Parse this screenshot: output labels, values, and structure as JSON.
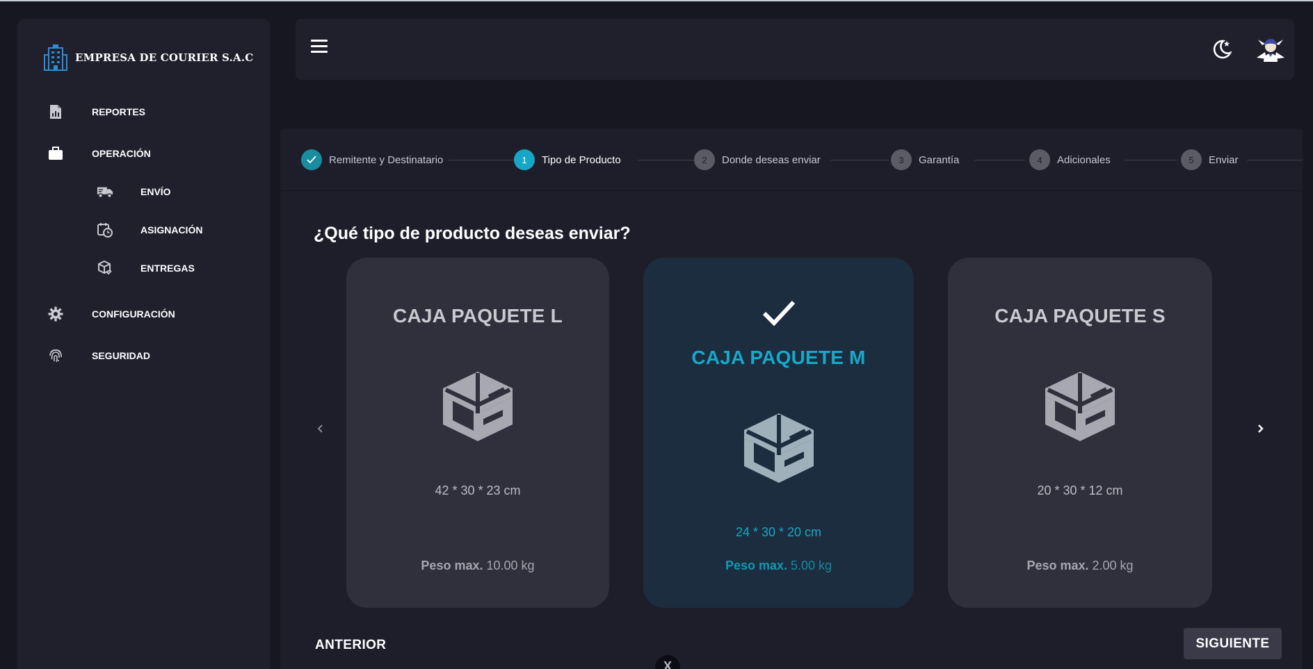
{
  "brand": {
    "name": "EMPRESA DE COURIER S.A.C"
  },
  "sidebar": {
    "items": [
      {
        "label": "REPORTES",
        "icon": "report-file-icon"
      },
      {
        "label": "OPERACIÓN",
        "icon": "briefcase-icon",
        "expanded": true
      },
      {
        "label": "ENVÍO",
        "icon": "truck-icon"
      },
      {
        "label": "ASIGNACIÓN",
        "icon": "calendar-clock-icon"
      },
      {
        "label": "ENTREGAS",
        "icon": "box-check-icon"
      },
      {
        "label": "CONFIGURACIÓN",
        "icon": "gear-icon"
      },
      {
        "label": "SEGURIDAD",
        "icon": "fingerprint-icon"
      }
    ]
  },
  "header": {
    "theme_icon": "moon-star-icon",
    "avatar_icon": "avatar-icon"
  },
  "stepper": {
    "steps": [
      {
        "num": "",
        "label": "Remitente y Destinatario",
        "state": "done"
      },
      {
        "num": "1",
        "label": "Tipo de Producto",
        "state": "active"
      },
      {
        "num": "2",
        "label": "Donde deseas enviar",
        "state": "pending"
      },
      {
        "num": "3",
        "label": "Garantía",
        "state": "pending"
      },
      {
        "num": "4",
        "label": "Adicionales",
        "state": "pending"
      },
      {
        "num": "5",
        "label": "Enviar",
        "state": "pending"
      }
    ]
  },
  "main": {
    "question": "¿Qué tipo de producto deseas enviar?",
    "cards": [
      {
        "title": "CAJA PAQUETE L",
        "dims": "42 * 30 * 23 cm",
        "weight_label": "Peso max.",
        "weight_value": "10.00 kg",
        "selected": false
      },
      {
        "title": "CAJA PAQUETE M",
        "dims": "24 * 30 * 20 cm",
        "weight_label": "Peso max.",
        "weight_value": "5.00 kg",
        "selected": true
      },
      {
        "title": "CAJA PAQUETE S",
        "dims": "20 * 30 * 12 cm",
        "weight_label": "Peso max.",
        "weight_value": "2.00 kg",
        "selected": false
      }
    ],
    "prev_label": "ANTERIOR",
    "next_label": "SIGUIENTE"
  },
  "colors": {
    "accent": "#17a7c6",
    "sidebar_bg": "#20202d",
    "card_bg": "#30303d",
    "card_selected_bg": "#1b2d3f"
  },
  "fab": {
    "label": "X"
  }
}
